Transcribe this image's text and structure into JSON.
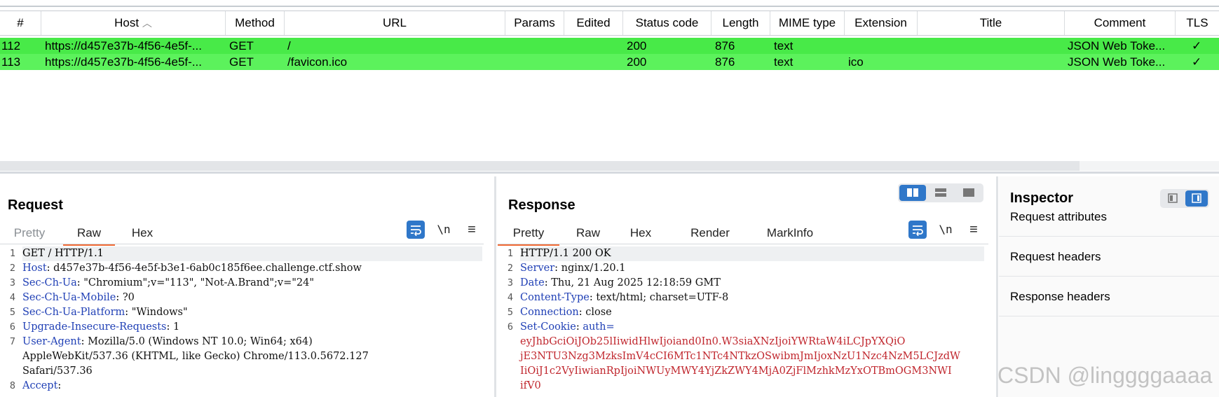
{
  "table": {
    "columns": [
      "#",
      "Host",
      "Method",
      "URL",
      "Params",
      "Edited",
      "Status code",
      "Length",
      "MIME type",
      "Extension",
      "Title",
      "Comment",
      "TLS"
    ],
    "sort_indicator": "^",
    "rows": [
      {
        "num": "112",
        "host": "https://d457e37b-4f56-4e5f-...",
        "method": "GET",
        "url": "/",
        "params": "",
        "edited": "",
        "status": "200",
        "length": "876",
        "mime": "text",
        "ext": "",
        "title": "",
        "comment": "JSON Web Toke...",
        "tls": "✓"
      },
      {
        "num": "113",
        "host": "https://d457e37b-4f56-4e5f-...",
        "method": "GET",
        "url": "/favicon.ico",
        "params": "",
        "edited": "",
        "status": "200",
        "length": "876",
        "mime": "text",
        "ext": "ico",
        "title": "",
        "comment": "JSON Web Toke...",
        "tls": "✓"
      }
    ]
  },
  "request": {
    "title": "Request",
    "tabs": [
      "Pretty",
      "Raw",
      "Hex"
    ],
    "active_tab": "Raw",
    "newline_label": "\\n",
    "lines": [
      {
        "n": "1",
        "key": "",
        "val": "GET / HTTP/1.1"
      },
      {
        "n": "2",
        "key": "Host",
        "val": "d457e37b-4f56-4e5f-b3e1-6ab0c185f6ee.challenge.ctf.show"
      },
      {
        "n": "3",
        "key": "Sec-Ch-Ua",
        "val": "\"Chromium\";v=\"113\", \"Not-A.Brand\";v=\"24\""
      },
      {
        "n": "4",
        "key": "Sec-Ch-Ua-Mobile",
        "val": "?0"
      },
      {
        "n": "5",
        "key": "Sec-Ch-Ua-Platform",
        "val": "\"Windows\""
      },
      {
        "n": "6",
        "key": "Upgrade-Insecure-Requests",
        "val": "1"
      },
      {
        "n": "7",
        "key": "User-Agent",
        "val": "Mozilla/5.0 (Windows NT 10.0; Win64; x64)"
      },
      {
        "n": "",
        "key": "",
        "val": "AppleWebKit/537.36 (KHTML, like Gecko) Chrome/113.0.5672.127"
      },
      {
        "n": "",
        "key": "",
        "val": "Safari/537.36"
      },
      {
        "n": "8",
        "key": "Accept",
        "val": ""
      }
    ]
  },
  "response": {
    "title": "Response",
    "tabs": [
      "Pretty",
      "Raw",
      "Hex",
      "Render",
      "MarkInfo"
    ],
    "active_tab": "Pretty",
    "newline_label": "\\n",
    "lines": [
      {
        "n": "1",
        "key": "",
        "val": "HTTP/1.1 200 OK",
        "red": false
      },
      {
        "n": "2",
        "key": "Server",
        "val": "nginx/1.20.1",
        "red": false
      },
      {
        "n": "3",
        "key": "Date",
        "val": "Thu, 21 Aug 2025 12:18:59 GMT",
        "red": false
      },
      {
        "n": "4",
        "key": "Content-Type",
        "val": "text/html; charset=UTF-8",
        "red": false
      },
      {
        "n": "5",
        "key": "Connection",
        "val": "close",
        "red": false
      },
      {
        "n": "6",
        "key": "Set-Cookie",
        "val": "auth=",
        "red": false
      },
      {
        "n": "",
        "key": "",
        "val": "eyJhbGciOiJOb25lIiwidHlwIjoiand0In0.W3siaXNzIjoiYWRtaW4iLCJpYXQiO",
        "red": true
      },
      {
        "n": "",
        "key": "",
        "val": "jE3NTU3Nzg3MzksImV4cCI6MTc1NTc4NTkzOSwibmJmIjoxNzU1Nzc4NzM5LCJzdW",
        "red": true
      },
      {
        "n": "",
        "key": "",
        "val": "IiOiJ1c2VyIiwianRpIjoiNWUyMWY4YjZkZWY4MjA0ZjFlMzhkMzYxOTBmOGM3NWI",
        "red": true
      },
      {
        "n": "",
        "key": "",
        "val": "ifV0",
        "red": true
      }
    ]
  },
  "inspector": {
    "title": "Inspector",
    "items": [
      "Request attributes",
      "Request headers",
      "Response headers"
    ]
  },
  "watermark": "CSDN @linggggaaaa"
}
